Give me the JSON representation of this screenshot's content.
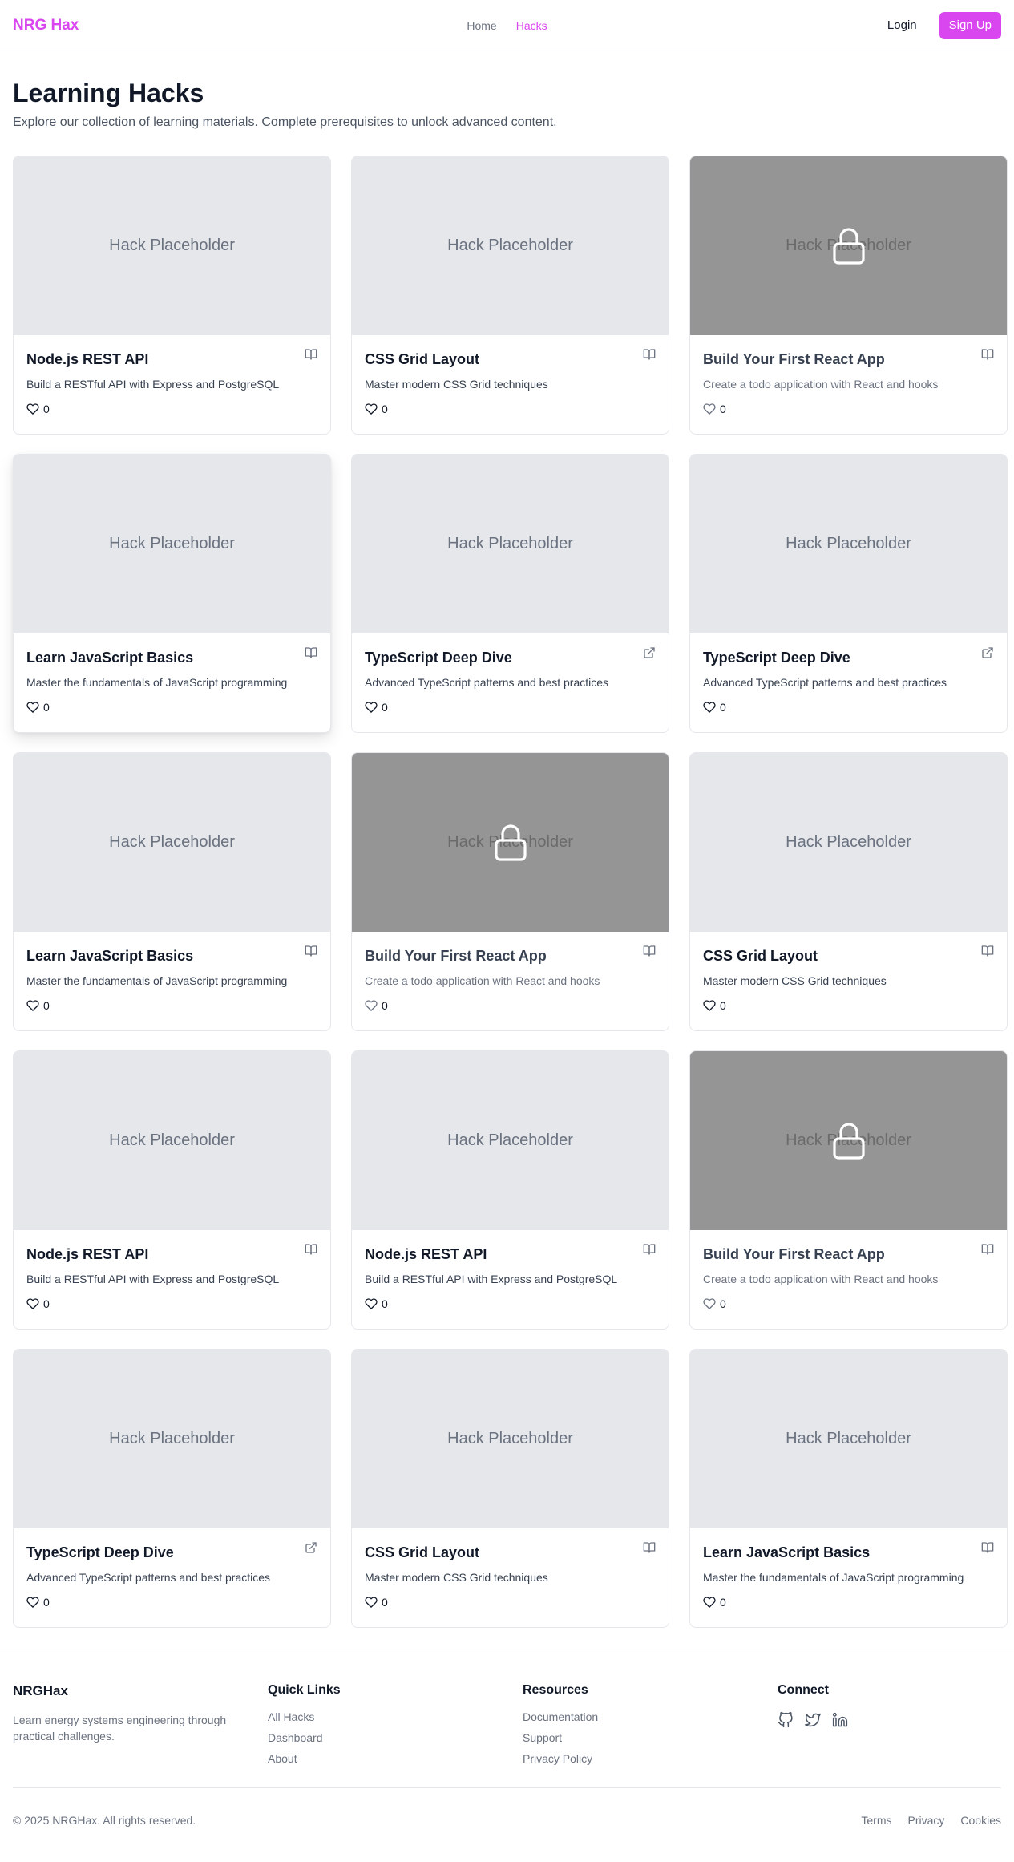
{
  "header": {
    "logo": "NRG Hax",
    "nav": [
      {
        "label": "Home",
        "active": false
      },
      {
        "label": "Hacks",
        "active": true
      }
    ],
    "login_label": "Login",
    "signup_label": "Sign Up"
  },
  "colors": {
    "brand": "#d946ef",
    "placeholder_bg": "#e5e7eb",
    "locked_bg": "#959595"
  },
  "page": {
    "title": "Learning Hacks",
    "subtitle": "Explore our collection of learning materials. Complete prerequisites to unlock advanced content."
  },
  "cards": [
    {
      "title": "Node.js REST API",
      "description": "Build a RESTful API with Express and PostgreSQL",
      "likes": "0",
      "locked": false,
      "type_icon": "book-open-icon",
      "placeholder": "Hack Placeholder"
    },
    {
      "title": "CSS Grid Layout",
      "description": "Master modern CSS Grid techniques",
      "likes": "0",
      "locked": false,
      "type_icon": "book-open-icon",
      "placeholder": "Hack Placeholder"
    },
    {
      "title": "Build Your First React App",
      "description": "Create a todo application with React and hooks",
      "likes": "0",
      "locked": true,
      "type_icon": "book-open-icon",
      "placeholder": "Hack Placeholder"
    },
    {
      "title": "Learn JavaScript Basics",
      "description": "Master the fundamentals of JavaScript programming",
      "likes": "0",
      "locked": false,
      "type_icon": "book-open-icon",
      "placeholder": "Hack Placeholder"
    },
    {
      "title": "TypeScript Deep Dive",
      "description": "Advanced TypeScript patterns and best practices",
      "likes": "0",
      "locked": false,
      "type_icon": "external-link-icon",
      "placeholder": "Hack Placeholder"
    },
    {
      "title": "TypeScript Deep Dive",
      "description": "Advanced TypeScript patterns and best practices",
      "likes": "0",
      "locked": false,
      "type_icon": "external-link-icon",
      "placeholder": "Hack Placeholder"
    },
    {
      "title": "Learn JavaScript Basics",
      "description": "Master the fundamentals of JavaScript programming",
      "likes": "0",
      "locked": false,
      "type_icon": "book-open-icon",
      "placeholder": "Hack Placeholder"
    },
    {
      "title": "Build Your First React App",
      "description": "Create a todo application with React and hooks",
      "likes": "0",
      "locked": true,
      "type_icon": "book-open-icon",
      "placeholder": "Hack Placeholder"
    },
    {
      "title": "CSS Grid Layout",
      "description": "Master modern CSS Grid techniques",
      "likes": "0",
      "locked": false,
      "type_icon": "book-open-icon",
      "placeholder": "Hack Placeholder"
    },
    {
      "title": "Node.js REST API",
      "description": "Build a RESTful API with Express and PostgreSQL",
      "likes": "0",
      "locked": false,
      "type_icon": "book-open-icon",
      "placeholder": "Hack Placeholder"
    },
    {
      "title": "Node.js REST API",
      "description": "Build a RESTful API with Express and PostgreSQL",
      "likes": "0",
      "locked": false,
      "type_icon": "book-open-icon",
      "placeholder": "Hack Placeholder"
    },
    {
      "title": "Build Your First React App",
      "description": "Create a todo application with React and hooks",
      "likes": "0",
      "locked": true,
      "type_icon": "book-open-icon",
      "placeholder": "Hack Placeholder"
    },
    {
      "title": "TypeScript Deep Dive",
      "description": "Advanced TypeScript patterns and best practices",
      "likes": "0",
      "locked": false,
      "type_icon": "external-link-icon",
      "placeholder": "Hack Placeholder"
    },
    {
      "title": "CSS Grid Layout",
      "description": "Master modern CSS Grid techniques",
      "likes": "0",
      "locked": false,
      "type_icon": "book-open-icon",
      "placeholder": "Hack Placeholder"
    },
    {
      "title": "Learn JavaScript Basics",
      "description": "Master the fundamentals of JavaScript programming",
      "likes": "0",
      "locked": false,
      "type_icon": "book-open-icon",
      "placeholder": "Hack Placeholder"
    }
  ],
  "footer": {
    "brand": "NRGHax",
    "tagline": "Learn energy systems engineering through practical challenges.",
    "quick_links": {
      "heading": "Quick Links",
      "items": [
        "All Hacks",
        "Dashboard",
        "About"
      ]
    },
    "resources": {
      "heading": "Resources",
      "items": [
        "Documentation",
        "Support",
        "Privacy Policy"
      ]
    },
    "connect": {
      "heading": "Connect",
      "icons": [
        "github-icon",
        "twitter-icon",
        "linkedin-icon"
      ]
    },
    "copyright": "© 2025 NRGHax. All rights reserved.",
    "legal": [
      "Terms",
      "Privacy",
      "Cookies"
    ]
  }
}
